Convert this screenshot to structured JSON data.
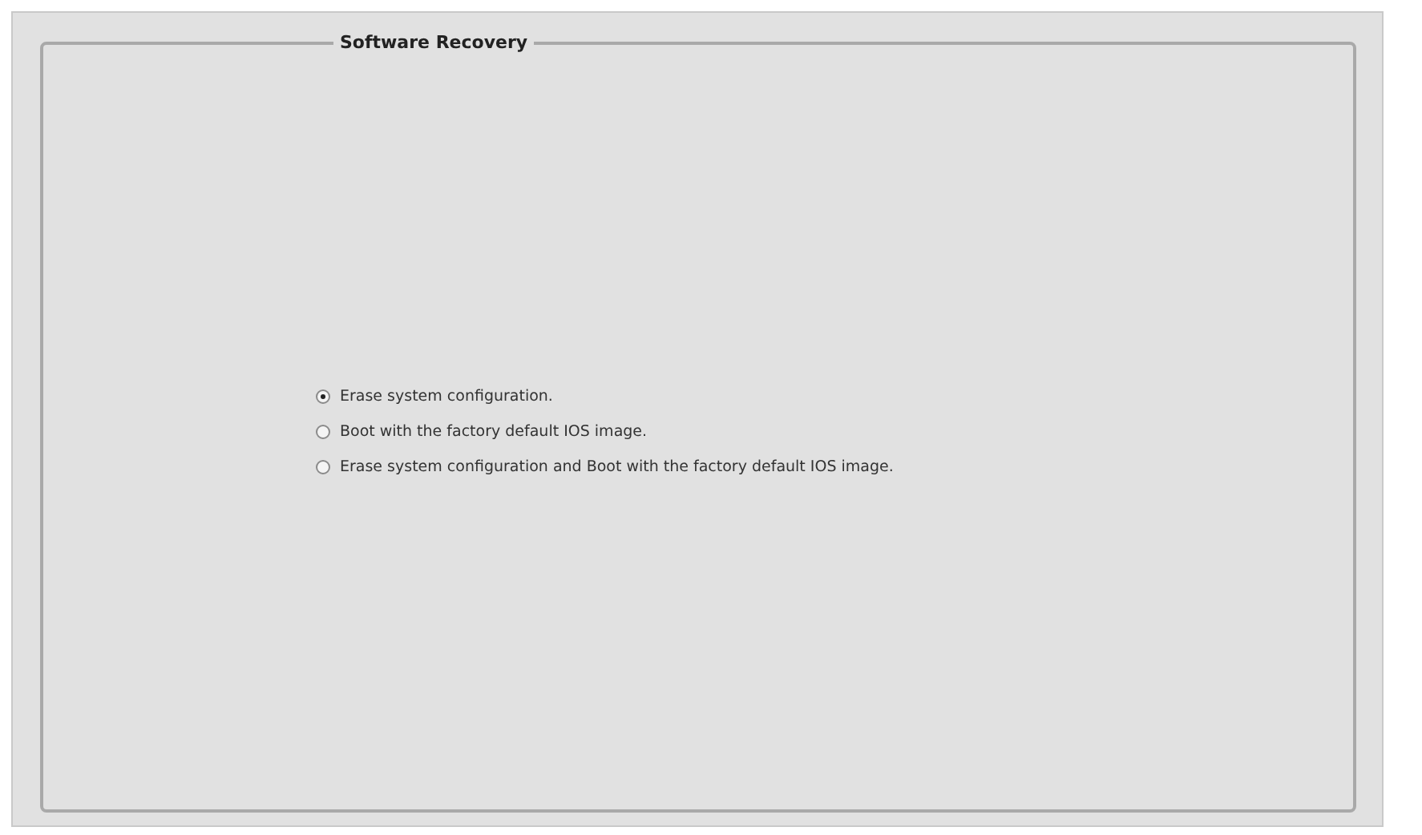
{
  "group": {
    "title": "Software Recovery"
  },
  "options": [
    {
      "label": "Erase system configuration.",
      "selected": true
    },
    {
      "label": "Boot with the factory default IOS image.",
      "selected": false
    },
    {
      "label": "Erase system configuration and Boot with the factory default IOS image.",
      "selected": false
    }
  ]
}
